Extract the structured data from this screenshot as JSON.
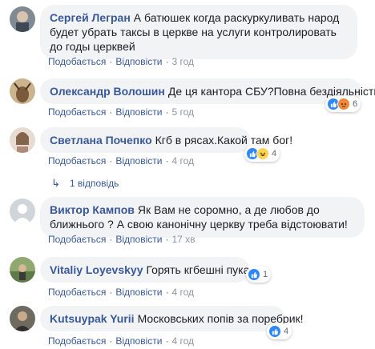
{
  "comments": [
    {
      "author": "Сергей Легран",
      "text": "А батюшек когда раскуркуливать народ будет убрать таксы в церкве на услуги контролировать до годы церквей",
      "actions": {
        "like": "Подобається",
        "reply": "Відповісти",
        "time": "3 год"
      }
    },
    {
      "author": "Олександр Волошин",
      "text": "Де ця кантора СБУ?Повна бездіяльність.",
      "actions": {
        "like": "Подобається",
        "reply": "Відповісти",
        "time": "5 год"
      },
      "reactions": {
        "icons": [
          "like-icon",
          "angry-icon"
        ],
        "count": "6"
      }
    },
    {
      "author": "Светлана Почепко",
      "text": "Кгб в рясах.Какой там бог!",
      "actions": {
        "like": "Подобається",
        "reply": "Відповісти",
        "time": "4 год"
      },
      "reactions": {
        "icons": [
          "like-icon",
          "haha-icon"
        ],
        "count": "4"
      }
    },
    {
      "author": "Виктор Кампов",
      "text": "Як Вам не соромно, а де любов до ближнього ? А свою канонічну церкву треба відстоювати!",
      "actions": {
        "like": "Подобається",
        "reply": "Відповісти",
        "time": "17 хв"
      }
    },
    {
      "author": "Vitaliy Loyevskyy",
      "text": "Горять кгбешні пукани.",
      "actions": {
        "like": "Подобається",
        "reply": "Відповісти",
        "time": "4 год"
      },
      "reactions": {
        "icons": [
          "like-icon"
        ],
        "count": "1"
      }
    },
    {
      "author": "Kutsuypak Yurii",
      "text": "Московських попів за поребрик!",
      "actions": {
        "like": "Подобається",
        "reply": "Відповісти",
        "time": "4 год"
      },
      "reactions": {
        "icons": [
          "like-icon"
        ],
        "count": "4"
      }
    }
  ],
  "replies_link": "1 відповідь",
  "colors": {
    "author": "#385898",
    "bubble": "#f2f3f5",
    "like": "#2d88ff"
  }
}
